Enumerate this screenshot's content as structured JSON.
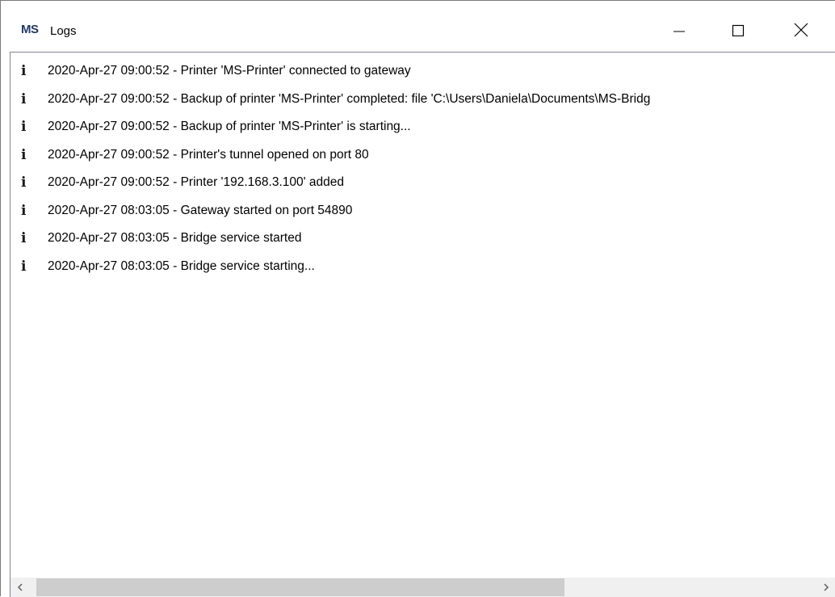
{
  "window": {
    "logo": "MS",
    "title": "Logs",
    "controls": {
      "minimize": "minimize-icon",
      "maximize": "maximize-icon",
      "close": "close-icon"
    }
  },
  "logs": [
    {
      "icon": "info-icon",
      "glyph": "i",
      "text": "2020-Apr-27 09:00:52 - Printer 'MS-Printer' connected to gateway"
    },
    {
      "icon": "info-icon",
      "glyph": "i",
      "text": "2020-Apr-27 09:00:52 - Backup of printer 'MS-Printer' completed: file 'C:\\Users\\Daniela\\Documents\\MS-Bridg"
    },
    {
      "icon": "info-icon",
      "glyph": "i",
      "text": "2020-Apr-27 09:00:52 - Backup of printer 'MS-Printer' is starting..."
    },
    {
      "icon": "info-icon",
      "glyph": "i",
      "text": "2020-Apr-27 09:00:52 - Printer's tunnel opened on port 80"
    },
    {
      "icon": "info-icon",
      "glyph": "i",
      "text": "2020-Apr-27 09:00:52 - Printer '192.168.3.100' added"
    },
    {
      "icon": "info-icon",
      "glyph": "i",
      "text": "2020-Apr-27 08:03:05 - Gateway started on port 54890"
    },
    {
      "icon": "info-icon",
      "glyph": "i",
      "text": "2020-Apr-27 08:03:05 - Bridge service started"
    },
    {
      "icon": "info-icon",
      "glyph": "i",
      "text": "2020-Apr-27 08:03:05 - Bridge service starting..."
    }
  ],
  "scrollbar": {
    "left_arrow": "chevron-left-icon",
    "right_arrow": "chevron-right-icon"
  }
}
